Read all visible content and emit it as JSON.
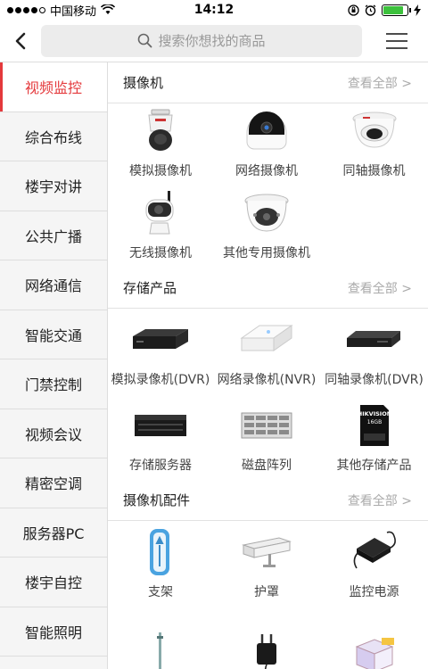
{
  "status_bar": {
    "carrier": "中国移动",
    "time": "14:12",
    "battery_level": 0.85
  },
  "header": {
    "search_placeholder": "搜索你想找的商品"
  },
  "sidebar": {
    "items": [
      {
        "label": "视频监控",
        "active": true
      },
      {
        "label": "综合布线"
      },
      {
        "label": "楼宇对讲"
      },
      {
        "label": "公共广播"
      },
      {
        "label": "网络通信"
      },
      {
        "label": "智能交通"
      },
      {
        "label": "门禁控制"
      },
      {
        "label": "视频会议"
      },
      {
        "label": "精密空调"
      },
      {
        "label": "服务器PC"
      },
      {
        "label": "楼宇自控"
      },
      {
        "label": "智能照明"
      }
    ]
  },
  "sections": [
    {
      "title": "摄像机",
      "more": "查看全部 >",
      "items": [
        {
          "label": "模拟摄像机",
          "icon": "ptz-dome-camera"
        },
        {
          "label": "网络摄像机",
          "icon": "network-camera"
        },
        {
          "label": "同轴摄像机",
          "icon": "coax-dome-camera"
        },
        {
          "label": "无线摄像机",
          "icon": "wireless-camera"
        },
        {
          "label": "其他专用摄像机",
          "icon": "special-camera"
        }
      ]
    },
    {
      "title": "存储产品",
      "more": "查看全部 >",
      "items": [
        {
          "label": "模拟录像机(DVR)",
          "icon": "dvr"
        },
        {
          "label": "网络录像机(NVR)",
          "icon": "nvr"
        },
        {
          "label": "同轴录像机(DVR)",
          "icon": "coax-dvr"
        },
        {
          "label": "存储服务器",
          "icon": "storage-server"
        },
        {
          "label": "磁盘阵列",
          "icon": "disk-array"
        },
        {
          "label": "其他存储产品",
          "icon": "sd-card",
          "card_brand": "HIKVISION",
          "card_size": "16GB"
        }
      ]
    },
    {
      "title": "摄像机配件",
      "more": "查看全部 >",
      "items": [
        {
          "label": "支架",
          "icon": "bracket"
        },
        {
          "label": "护罩",
          "icon": "housing"
        },
        {
          "label": "监控电源",
          "icon": "power-supply"
        }
      ]
    }
  ]
}
